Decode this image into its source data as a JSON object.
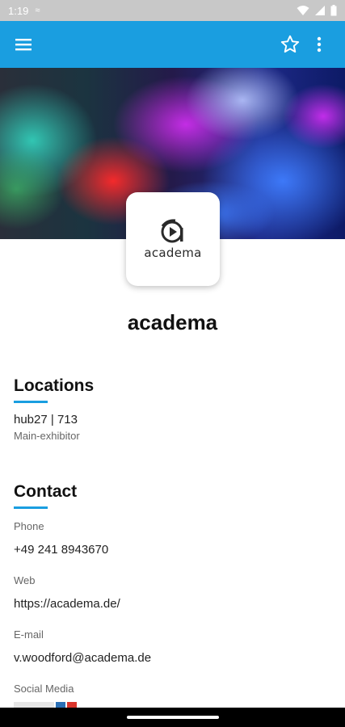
{
  "status": {
    "time": "1:19",
    "extra": "≈"
  },
  "app_bar": {
    "menu_icon": "menu-icon",
    "favorite_icon": "star-outline-icon",
    "overflow_icon": "more-vertical-icon"
  },
  "exhibitor": {
    "name": "academa",
    "logo_text": "academa"
  },
  "locations": {
    "title": "Locations",
    "items": [
      {
        "name": "hub27 | 713",
        "role": "Main-exhibitor"
      }
    ]
  },
  "contact": {
    "title": "Contact",
    "phone_label": "Phone",
    "phone_value": "+49 241 8943670",
    "web_label": "Web",
    "web_value": "https://academa.de/",
    "email_label": "E-mail",
    "email_value": "v.woodford@academa.de",
    "social_label": "Social Media"
  },
  "colors": {
    "accent": "#1a9ee0",
    "status_bar": "#c8c8c8"
  }
}
